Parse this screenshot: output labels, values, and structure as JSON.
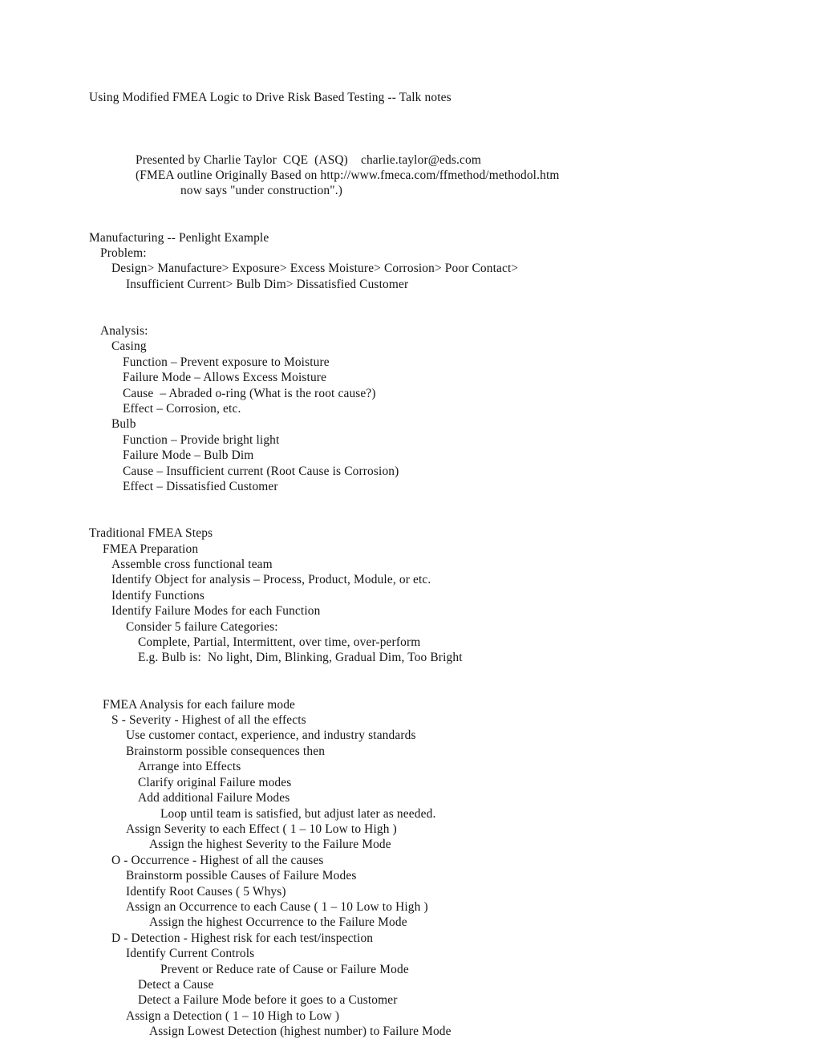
{
  "document": {
    "title": "Using Modified FMEA Logic to Drive Risk Based Testing -- Talk notes",
    "byline": {
      "presenter_line": "Presented by Charlie Taylor  CQE  (ASQ)    charlie.taylor@eds.com",
      "source_line": "(FMEA outline Originally Based on http://www.fmeca.com/ffmethod/methodol.htm",
      "source_line_cont": "now says \"under construction\".)"
    },
    "sections": [
      {
        "heading": "Manufacturing -- Penlight Example",
        "lines": [
          {
            "text": "Problem:",
            "indent": 1
          },
          {
            "text": "Design> Manufacture> Exposure> Excess Moisture> Corrosion> Poor Contact>",
            "indent": 2
          },
          {
            "text": "Insufficient Current> Bulb Dim> Dissatisfied Customer",
            "indent": 4
          },
          {
            "text": "",
            "indent": 0
          },
          {
            "text": "Analysis:",
            "indent": 1
          },
          {
            "text": "Casing",
            "indent": 2
          },
          {
            "text": "Function – Prevent exposure to Moisture",
            "indent": 3
          },
          {
            "text": "Failure Mode – Allows Excess Moisture",
            "indent": 3
          },
          {
            "text": "Cause  – Abraded o-ring (What is the root cause?)",
            "indent": 3
          },
          {
            "text": "Effect – Corrosion, etc.",
            "indent": 3
          },
          {
            "text": "Bulb",
            "indent": 2
          },
          {
            "text": "Function – Provide bright light",
            "indent": 3
          },
          {
            "text": "Failure Mode – Bulb Dim",
            "indent": 3
          },
          {
            "text": "Cause – Insufficient current (Root Cause is Corrosion)",
            "indent": 3
          },
          {
            "text": "Effect – Dissatisfied Customer",
            "indent": 3
          }
        ]
      },
      {
        "heading": "Traditional FMEA Steps",
        "lines": [
          {
            "text": "FMEA Preparation",
            "indent": 1
          },
          {
            "text": "Assemble cross functional team",
            "indent": 2
          },
          {
            "text": "Identify Object for analysis – Process, Product, Module, or etc.",
            "indent": 2
          },
          {
            "text": "Identify Functions",
            "indent": 2
          },
          {
            "text": "Identify Failure Modes for each Function",
            "indent": 2
          },
          {
            "text": "Consider 5 failure Categories:",
            "indent": 3
          },
          {
            "text": "Complete, Partial, Intermittent, over time, over-perform",
            "indent": 4
          },
          {
            "text": "E.g. Bulb is:  No light, Dim, Blinking, Gradual Dim, Too Bright",
            "indent": 4
          },
          {
            "text": "",
            "indent": 0
          },
          {
            "text": "FMEA Analysis for each failure mode",
            "indent": 1
          },
          {
            "text": "S - Severity - Highest of all the effects",
            "indent": 2
          },
          {
            "text": "Use customer contact, experience, and industry standards",
            "indent": 3
          },
          {
            "text": "Brainstorm possible consequences then",
            "indent": 3
          },
          {
            "text": "Arrange into Effects",
            "indent": 4
          },
          {
            "text": "Clarify original Failure modes",
            "indent": 4
          },
          {
            "text": "Add additional Failure Modes",
            "indent": 4
          },
          {
            "text": "Loop until team is satisfied, but adjust later as needed.",
            "indent": 5
          },
          {
            "text": "Assign Severity to each Effect ( 1 – 10 Low to High )",
            "indent": 3
          },
          {
            "text": "Assign the highest Severity to the Failure Mode",
            "indent": 4
          },
          {
            "text": "O - Occurrence - Highest of all the causes",
            "indent": 2
          },
          {
            "text": "Brainstorm possible Causes of Failure Modes",
            "indent": 3
          },
          {
            "text": "Identify Root Causes ( 5 Whys)",
            "indent": 3
          },
          {
            "text": "Assign an Occurrence to each Cause ( 1 – 10 Low to High )",
            "indent": 3
          },
          {
            "text": "Assign the highest Occurrence to the Failure Mode",
            "indent": 4
          },
          {
            "text": "D - Detection - Highest risk for each test/inspection",
            "indent": 2
          },
          {
            "text": "Identify Current Controls",
            "indent": 3
          },
          {
            "text": "Prevent or Reduce rate of Cause or Failure Mode",
            "indent": 5
          },
          {
            "text": "Detect a Cause",
            "indent": 4
          },
          {
            "text": "Detect a Failure Mode before it goes to a Customer",
            "indent": 4
          },
          {
            "text": "Assign a Detection ( 1 – 10 High to Low )",
            "indent": 3
          },
          {
            "text": "Assign Lowest Detection (highest number) to Failure Mode",
            "indent": 4
          }
        ]
      }
    ]
  }
}
